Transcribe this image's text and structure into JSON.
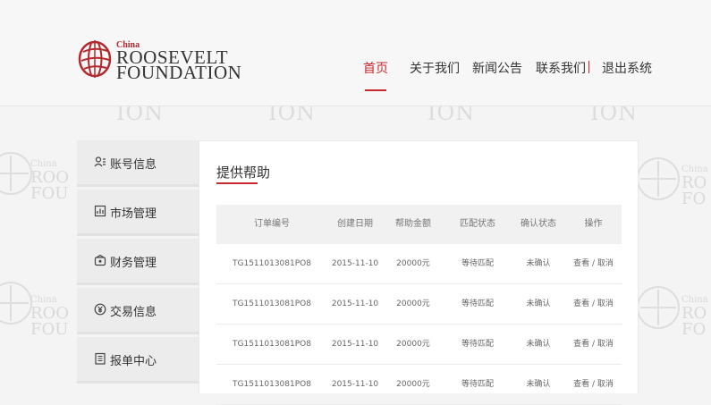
{
  "header": {
    "logo": {
      "small": "China",
      "line1": "ROOSEVELT",
      "line2": "FOUNDATION"
    },
    "nav": [
      {
        "label": "首页",
        "active": true
      },
      {
        "label": "关于我们",
        "active": false
      },
      {
        "label": "新闻公告",
        "active": false
      },
      {
        "label": "联系我们",
        "active": false
      },
      {
        "label": "退出系统",
        "active": false
      }
    ]
  },
  "sidebar": {
    "items": [
      {
        "label": "账号信息",
        "icon": "user-card-icon"
      },
      {
        "label": "市场管理",
        "icon": "chart-doc-icon"
      },
      {
        "label": "财务管理",
        "icon": "wallet-icon"
      },
      {
        "label": "交易信息",
        "icon": "yen-coin-icon"
      },
      {
        "label": "报单中心",
        "icon": "document-list-icon"
      }
    ]
  },
  "main": {
    "title": "提供帮助",
    "table": {
      "headers": [
        "订单编号",
        "创建日期",
        "帮助金额",
        "匹配状态",
        "确认状态",
        "操作"
      ],
      "rows": [
        {
          "order": "TG1511013081PO8",
          "date": "2015-11-10",
          "amount": "20000元",
          "match": "等待匹配",
          "confirm": "未确认",
          "view": "查看",
          "sep": "/",
          "cancel": "取消"
        },
        {
          "order": "TG1511013081PO8",
          "date": "2015-11-10",
          "amount": "20000元",
          "match": "等待匹配",
          "confirm": "未确认",
          "view": "查看",
          "sep": "/",
          "cancel": "取消"
        },
        {
          "order": "TG1511013081PO8",
          "date": "2015-11-10",
          "amount": "20000元",
          "match": "等待匹配",
          "confirm": "未确认",
          "view": "查看",
          "sep": "/",
          "cancel": "取消"
        },
        {
          "order": "TG1511013081PO8",
          "date": "2015-11-10",
          "amount": "20000元",
          "match": "等待匹配",
          "confirm": "未确认",
          "view": "查看",
          "sep": "/",
          "cancel": "取消"
        }
      ]
    }
  },
  "colors": {
    "accent": "#c9282e",
    "background": "#f4f4f4",
    "panel": "#ffffff",
    "table_header": "#f1f1f1"
  }
}
